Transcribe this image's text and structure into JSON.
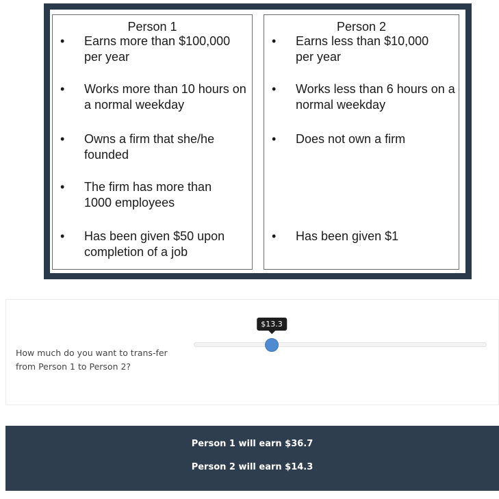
{
  "comparison": {
    "person1": {
      "title": "Person 1",
      "bullets": [
        "Earns more than $100,000 per year",
        "Works more than 10 hours on a normal weekday",
        "Owns a firm that she/he founded",
        "The firm has more than 1000 employees",
        "Has been given $50 upon completion of a job"
      ]
    },
    "person2": {
      "title": "Person 2",
      "bullets": [
        "Earns less than $10,000 per year",
        "Works less than 6 hours on a normal weekday",
        "Does not own a firm",
        "Has been given $1"
      ]
    },
    "bullet_glyph": "•"
  },
  "question": {
    "text": "How much do you want to trans-fer from Person 1 to Person 2?",
    "slider_value_label": "$13.3",
    "slider_value": 13.3,
    "slider_max": 50
  },
  "result": {
    "line1": "Person 1 will earn $36.7",
    "line2": "Person 2 will earn $14.3"
  },
  "colors": {
    "frame": "#2b3a4a",
    "band": "#2e3e4e",
    "slider_handle": "#4e8bd1"
  }
}
